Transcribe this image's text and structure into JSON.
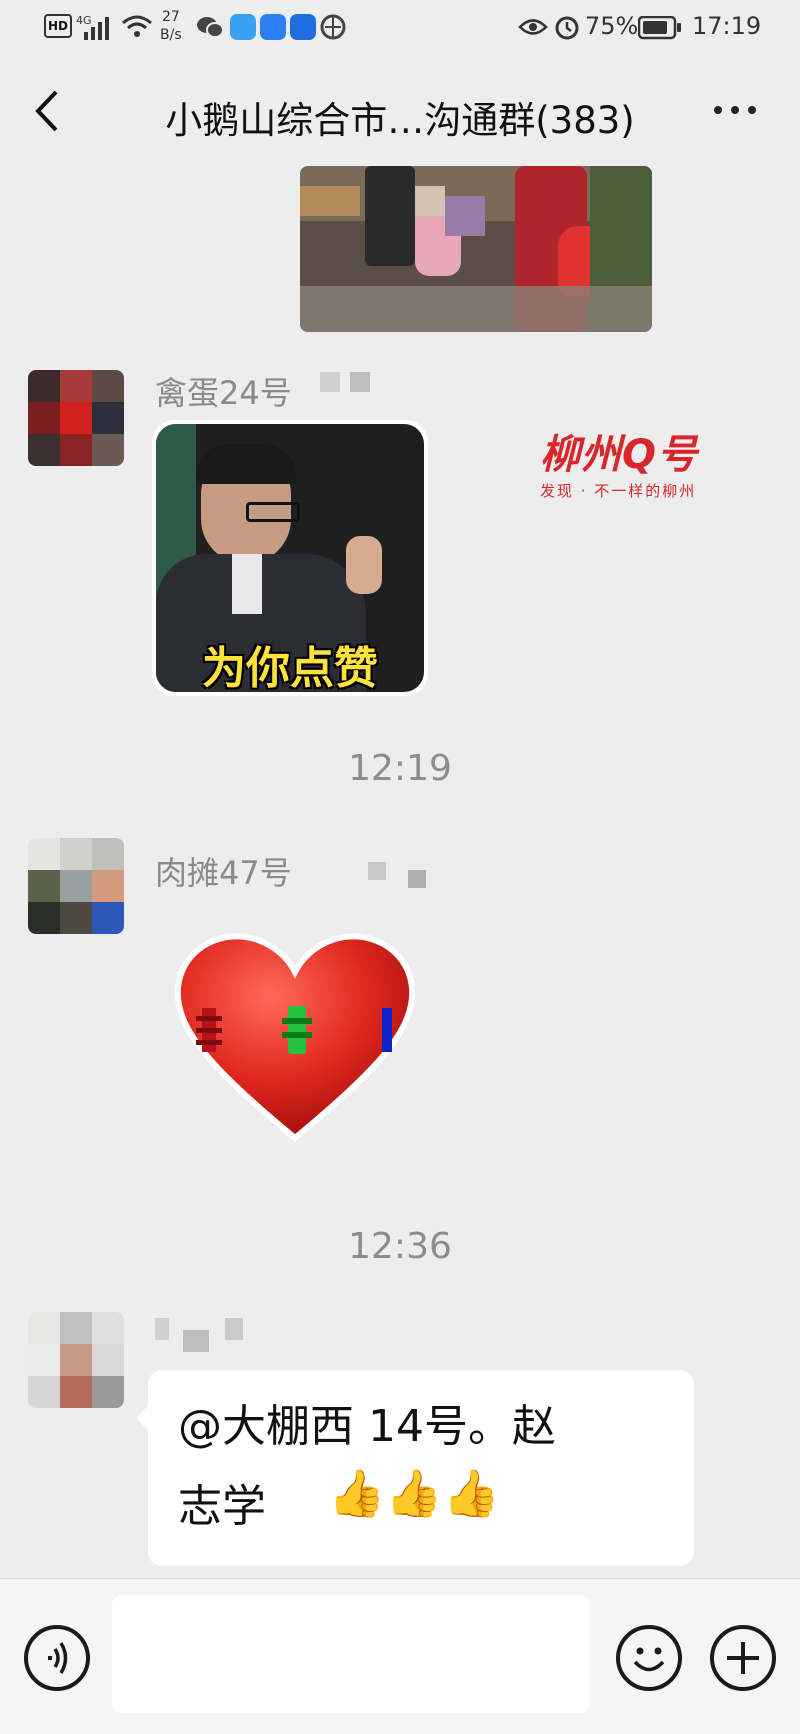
{
  "status_bar": {
    "hd": "HD",
    "network": "4G",
    "speed_top": "27",
    "speed_bottom": "B/s",
    "battery": "75%",
    "time": "17:19"
  },
  "header": {
    "title": "小鹅山综合市…沟通群(383)",
    "back_icon": "chevron-left-icon",
    "more_icon": "more-dots-icon"
  },
  "messages": [
    {
      "type": "image",
      "description_icon": "market-photo"
    },
    {
      "type": "sticker",
      "sender": "禽蛋24号",
      "sticker_text": "为你点赞"
    },
    {
      "type": "time",
      "text": "12:19"
    },
    {
      "type": "sticker",
      "sender": "肉摊47号"
    },
    {
      "type": "time",
      "text": "12:36"
    },
    {
      "type": "text",
      "line1": "@大棚西 14号。赵",
      "line2": "志学",
      "emoji": "👍👍👍"
    }
  ],
  "watermark": {
    "brand": "柳州Q号",
    "slogan": "发现 · 不一样的柳州"
  },
  "input_bar": {
    "voice_icon": "voice-icon",
    "emoji_icon": "smiley-icon",
    "plus_icon": "plus-icon"
  }
}
